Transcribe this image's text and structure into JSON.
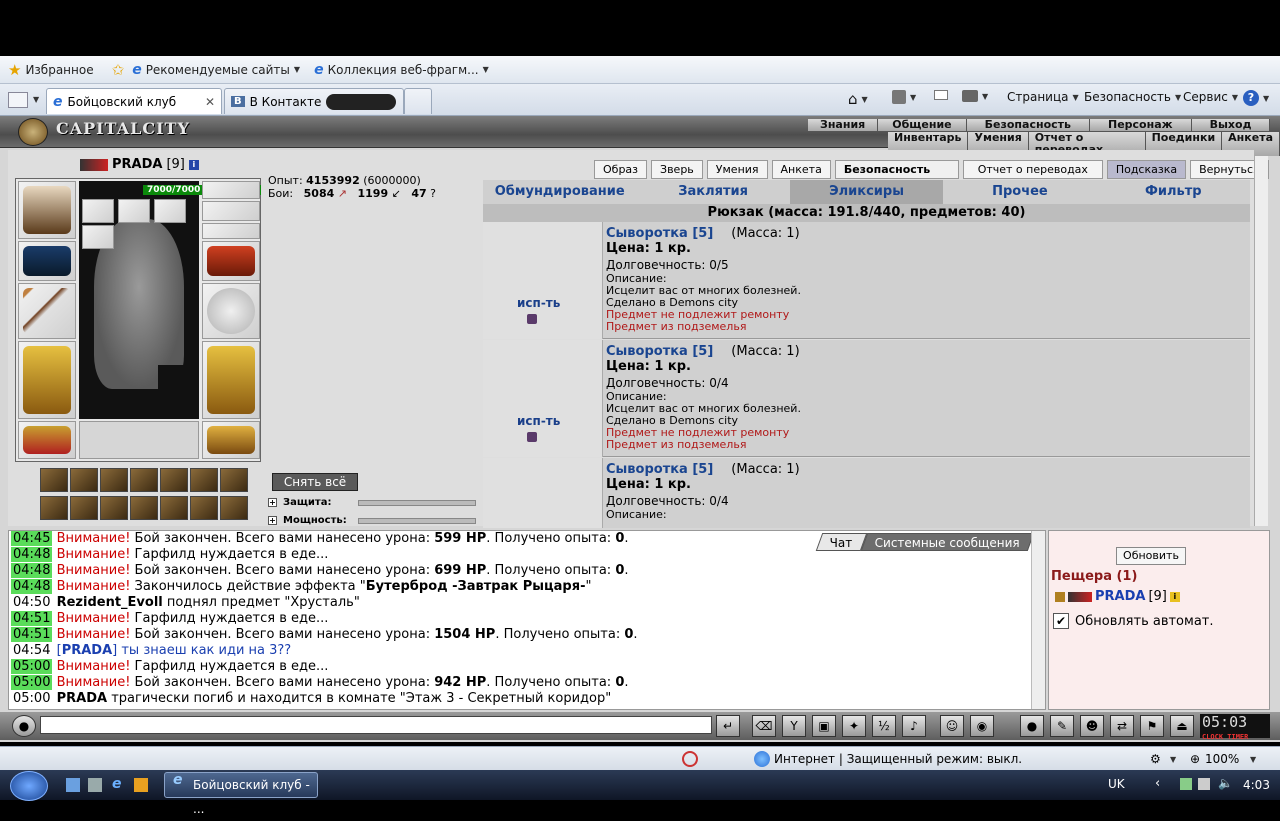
{
  "favorites_bar": {
    "favorites": "Избранное",
    "recommended": "Рекомендуемые сайты",
    "webslices": "Коллекция веб-фрагм..."
  },
  "tabs": [
    {
      "label": "Бойцовский клуб"
    },
    {
      "label": "В Контакте"
    }
  ],
  "command_bar": {
    "page": "Страница",
    "safety": "Безопасность",
    "service": "Сервис"
  },
  "game": {
    "logo": "CAPITALCITY",
    "top_menu_1": [
      "Знания",
      "Общение",
      "Безопасность",
      "Персонаж",
      "Выход"
    ],
    "top_menu_2": [
      "Инвентарь",
      "Умения",
      "Отчет о переводах",
      "Поединки",
      "Анкета"
    ],
    "character": {
      "name": "PRADA",
      "level": "[9]",
      "hp": "7000/7000"
    },
    "stats": {
      "exp_label": "Опыт:",
      "exp": "4153992",
      "exp_next": "(6000000)",
      "fights_label": "Бои:",
      "wins": "5084",
      "losses": "1199",
      "draws": "47"
    },
    "undress_button": "Снять всё",
    "protection_label": "Защита:",
    "power_label": "Мощность:",
    "top_buttons": [
      "Образ",
      "Зверь",
      "Умения",
      "Анкета",
      "Безопасность",
      "Отчет о переводах",
      "Подсказка",
      "Вернуться"
    ],
    "inv_tabs": [
      "Обмундирование",
      "Заклятия",
      "Эликсиры",
      "Прочее",
      "Фильтр"
    ],
    "backpack": "Рюкзак (масса: 191.8/440, предметов: 40)",
    "use_label": "исп-ть",
    "items": [
      {
        "name": "Сыворотка [5]",
        "mass": "(Масса: 1)",
        "price": "Цена: 1 кр.",
        "durability": "Долговечность: 0/5",
        "desc_label": "Описание:",
        "desc": "Исцелит вас от многих болезней.",
        "made": "Сделано в Demons city",
        "note1": "Предмет не подлежит ремонту",
        "note2": "Предмет из подземелья"
      },
      {
        "name": "Сыворотка [5]",
        "mass": "(Масса: 1)",
        "price": "Цена: 1 кр.",
        "durability": "Долговечность: 0/4",
        "desc_label": "Описание:",
        "desc": "Исцелит вас от многих болезней.",
        "made": "Сделано в Demons city",
        "note1": "Предмет не подлежит ремонту",
        "note2": "Предмет из подземелья"
      },
      {
        "name": "Сыворотка [5]",
        "mass": "(Масса: 1)",
        "price": "Цена: 1 кр.",
        "durability": "Долговечность: 0/4",
        "desc_label": "Описание:",
        "desc": "",
        "made": "",
        "note1": "",
        "note2": ""
      }
    ],
    "chat_tabs": {
      "chat": "Чат",
      "system": "Системные сообщения"
    },
    "chat": [
      {
        "time": "04:45",
        "hl": true,
        "pre": "Внимание!",
        "text": " Бой закончен. Всего вами нанесено урона: ",
        "b": "599 HP",
        "post": ". Получено опыта: ",
        "b2": "0",
        "end": "."
      },
      {
        "time": "04:48",
        "hl": true,
        "pre": "Внимание!",
        "text": " Гарфилд нуждается в еде...",
        "b": "",
        "post": "",
        "b2": "",
        "end": ""
      },
      {
        "time": "04:48",
        "hl": true,
        "pre": "Внимание!",
        "text": " Бой закончен. Всего вами нанесено урона: ",
        "b": "699 HP",
        "post": ". Получено опыта: ",
        "b2": "0",
        "end": "."
      },
      {
        "time": "04:48",
        "hl": true,
        "pre": "Внимание!",
        "text": " Закончилось действие эффекта \"",
        "b": "Бутерброд -Завтрак Рыцаря-",
        "post": "\"",
        "b2": "",
        "end": ""
      },
      {
        "time": "04:50",
        "hl": false,
        "pre": "",
        "text": "",
        "b": "Rezident_Evoll",
        "post": " поднял предмет \"Хрусталь\"",
        "b2": "",
        "end": ""
      },
      {
        "time": "04:51",
        "hl": true,
        "pre": "Внимание!",
        "text": " Гарфилд нуждается в еде...",
        "b": "",
        "post": "",
        "b2": "",
        "end": ""
      },
      {
        "time": "04:51",
        "hl": true,
        "pre": "Внимание!",
        "text": " Бой закончен. Всего вами нанесено урона: ",
        "b": "1504 HP",
        "post": ". Получено опыта: ",
        "b2": "0",
        "end": "."
      },
      {
        "time": "04:54",
        "hl": false,
        "pre": "",
        "text": "[",
        "b": "PRADA",
        "post": "] ты знаеш как иди на 3??",
        "b2": "",
        "end": "",
        "blue": true
      },
      {
        "time": "05:00",
        "hl": true,
        "pre": "Внимание!",
        "text": " Гарфилд нуждается в еде...",
        "b": "",
        "post": "",
        "b2": "",
        "end": ""
      },
      {
        "time": "05:00",
        "hl": true,
        "pre": "Внимание!",
        "text": " Бой закончен. Всего вами нанесено урона: ",
        "b": "942 HP",
        "post": ". Получено опыта: ",
        "b2": "0",
        "end": "."
      },
      {
        "time": "05:00",
        "hl": false,
        "pre": "",
        "text": "",
        "b": "PRADA",
        "post": " трагически погиб и находится в комнате \"Этаж 3 - Секретный коридор\"",
        "b2": "",
        "end": ""
      }
    ],
    "sidebar": {
      "refresh": "Обновить",
      "location": "Пещера (1)",
      "player": "PRADA",
      "player_level": "[9]",
      "auto_refresh": "Обновлять автомат."
    },
    "clock": "05:03",
    "clock_label": "CLOCK TIMER"
  },
  "status_bar": {
    "zone": "Интернет | Защищенный режим: выкл.",
    "zoom": "100%"
  },
  "taskbar": {
    "task": "Бойцовский клуб - ...",
    "lang": "UK",
    "time": "4:03"
  }
}
